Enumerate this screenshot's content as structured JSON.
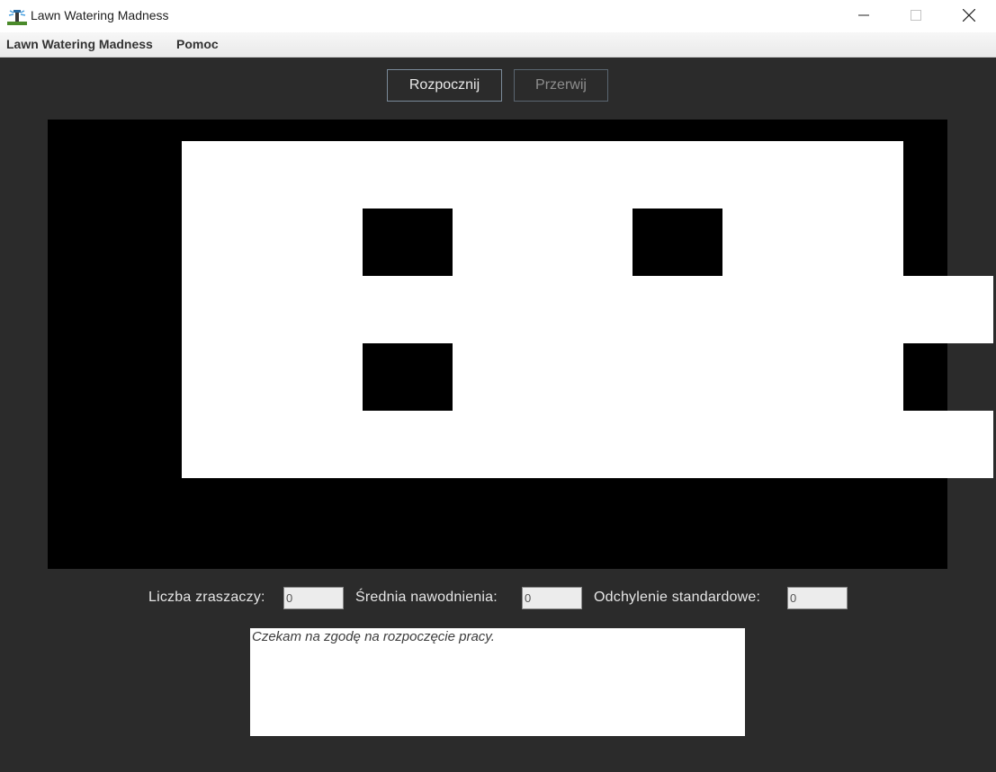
{
  "window": {
    "title": "Lawn Watering Madness",
    "minimize_icon": "minimize-icon",
    "maximize_icon": "maximize-icon",
    "close_icon": "close-icon"
  },
  "menu": {
    "items": [
      "Lawn Watering Madness",
      "Pomoc"
    ]
  },
  "toolbar": {
    "start_label": "Rozpocznij",
    "stop_label": "Przerwij",
    "stop_enabled": false
  },
  "lawn": {
    "rows": 5,
    "cols": 10,
    "legend": "1 = lawn (white), 0 = obstacle (black)",
    "grid": [
      [
        0,
        1,
        1,
        1,
        1,
        1,
        1,
        1,
        1,
        0
      ],
      [
        0,
        1,
        1,
        0,
        1,
        1,
        0,
        1,
        1,
        0
      ],
      [
        0,
        1,
        1,
        1,
        1,
        1,
        1,
        1,
        1,
        1
      ],
      [
        0,
        1,
        1,
        0,
        1,
        1,
        1,
        1,
        1,
        0
      ],
      [
        0,
        1,
        1,
        1,
        1,
        1,
        1,
        1,
        1,
        1
      ]
    ]
  },
  "stats": {
    "sprinklers_label": "Liczba zraszaczy:",
    "sprinklers_value": "0",
    "avg_label": "Średnia nawodnienia:",
    "avg_value": "0",
    "std_label": "Odchylenie standardowe:",
    "std_value": "0"
  },
  "log": {
    "message": "Czekam na zgodę na rozpoczęcie pracy."
  },
  "colors": {
    "background": "#2b2b2b",
    "lawn": "#ffffff",
    "obstacle": "#000000"
  }
}
